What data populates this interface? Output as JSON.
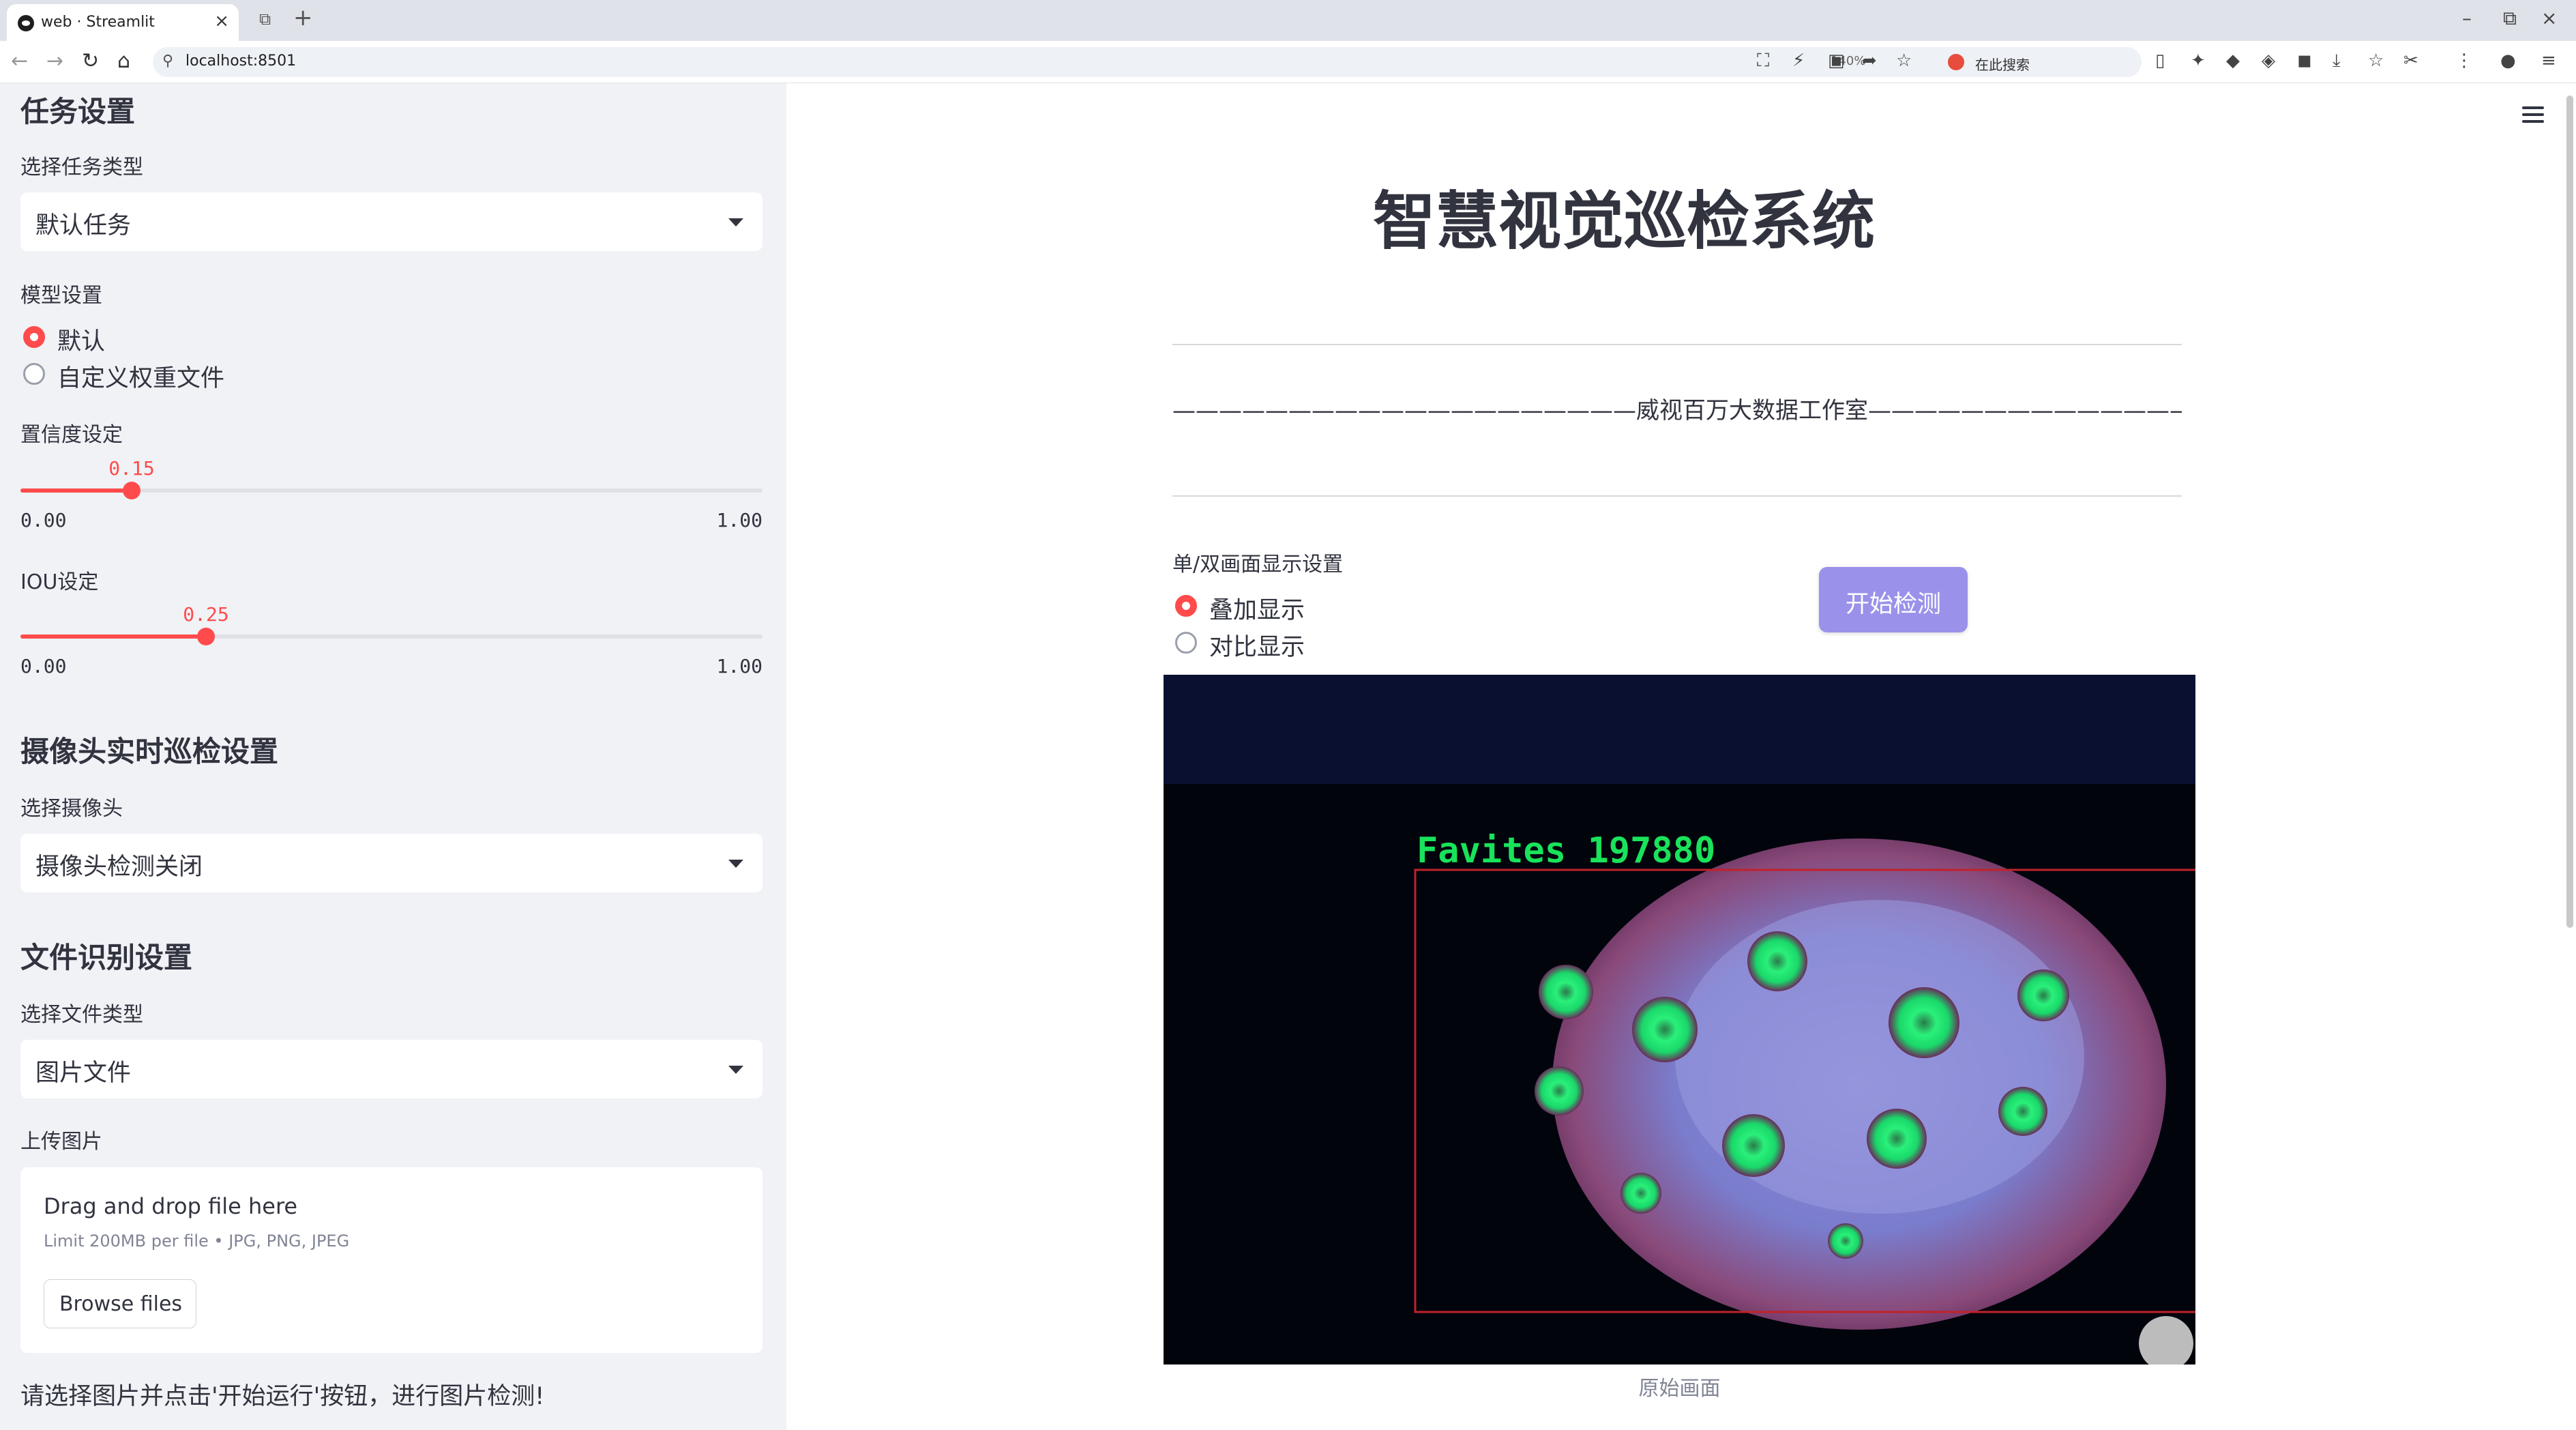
{
  "browser": {
    "tab_title": "web · Streamlit",
    "url": "localhost:8501",
    "zoom": "140%",
    "search_placeholder": "在此搜索"
  },
  "sidebar": {
    "task_heading": "任务设置",
    "task_type_label": "选择任务类型",
    "task_type_value": "默认任务",
    "model_label": "模型设置",
    "model_options": [
      "默认",
      "自定义权重文件"
    ],
    "model_selected": "默认",
    "confidence": {
      "label": "置信度设定",
      "value": 0.15,
      "value_text": "0.15",
      "min_text": "0.00",
      "max_text": "1.00"
    },
    "iou": {
      "label": "IOU设定",
      "value": 0.25,
      "value_text": "0.25",
      "min_text": "0.00",
      "max_text": "1.00"
    },
    "camera_heading": "摄像头实时巡检设置",
    "camera_label": "选择摄像头",
    "camera_value": "摄像头检测关闭",
    "file_heading": "文件识别设置",
    "file_type_label": "选择文件类型",
    "file_type_value": "图片文件",
    "upload_label": "上传图片",
    "uploader": {
      "title": "Drag and drop file here",
      "limit": "Limit 200MB per file • JPG, PNG, JPEG",
      "button": "Browse files"
    },
    "note": "请选择图片并点击'开始运行'按钮，进行图片检测!"
  },
  "main": {
    "title": "智慧视觉巡检系统",
    "studio_line": "————————————————————威视百万大数据工作室—————————————————————",
    "display_label": "单/双画面显示设置",
    "display_options": [
      "叠加显示",
      "对比显示"
    ],
    "display_selected": "叠加显示",
    "start_button": "开始检测",
    "detection_label": "Favites 197880",
    "image_caption": "原始画面"
  },
  "colors": {
    "accent": "#ff4b4b",
    "button": "#9a92ea",
    "detection_box": "#c0222a",
    "detection_text": "#19e35a"
  }
}
